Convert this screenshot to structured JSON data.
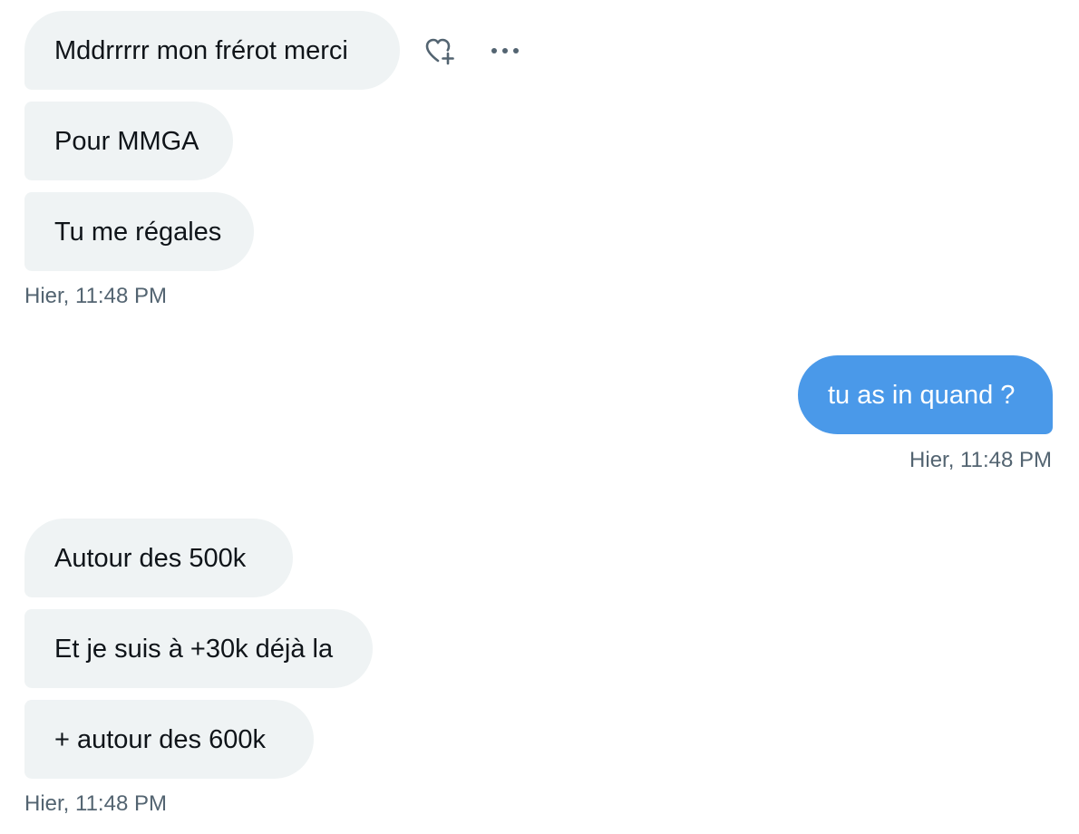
{
  "conversation": {
    "group1": {
      "messages": [
        {
          "text": "Mddrrrrr mon frérot merci"
        },
        {
          "text": "Pour MMGA"
        },
        {
          "text": "Tu me régales"
        }
      ],
      "timestamp": "Hier, 11:48 PM"
    },
    "sent": {
      "messages": [
        {
          "text": "tu as in quand ?"
        }
      ],
      "timestamp": "Hier, 11:48 PM"
    },
    "group2": {
      "messages": [
        {
          "text": "Autour des 500k"
        },
        {
          "text": "Et je suis à +30k déjà la"
        },
        {
          "text": "+ autour des 600k"
        }
      ],
      "timestamp": "Hier, 11:48 PM"
    }
  },
  "actions": {
    "react_icon": "heart-plus-icon",
    "more_icon": "more-dots-icon"
  },
  "colors": {
    "received_bubble": "#eff3f4",
    "sent_bubble": "#4a99e9",
    "timestamp": "#536471",
    "text": "#0f1419"
  }
}
